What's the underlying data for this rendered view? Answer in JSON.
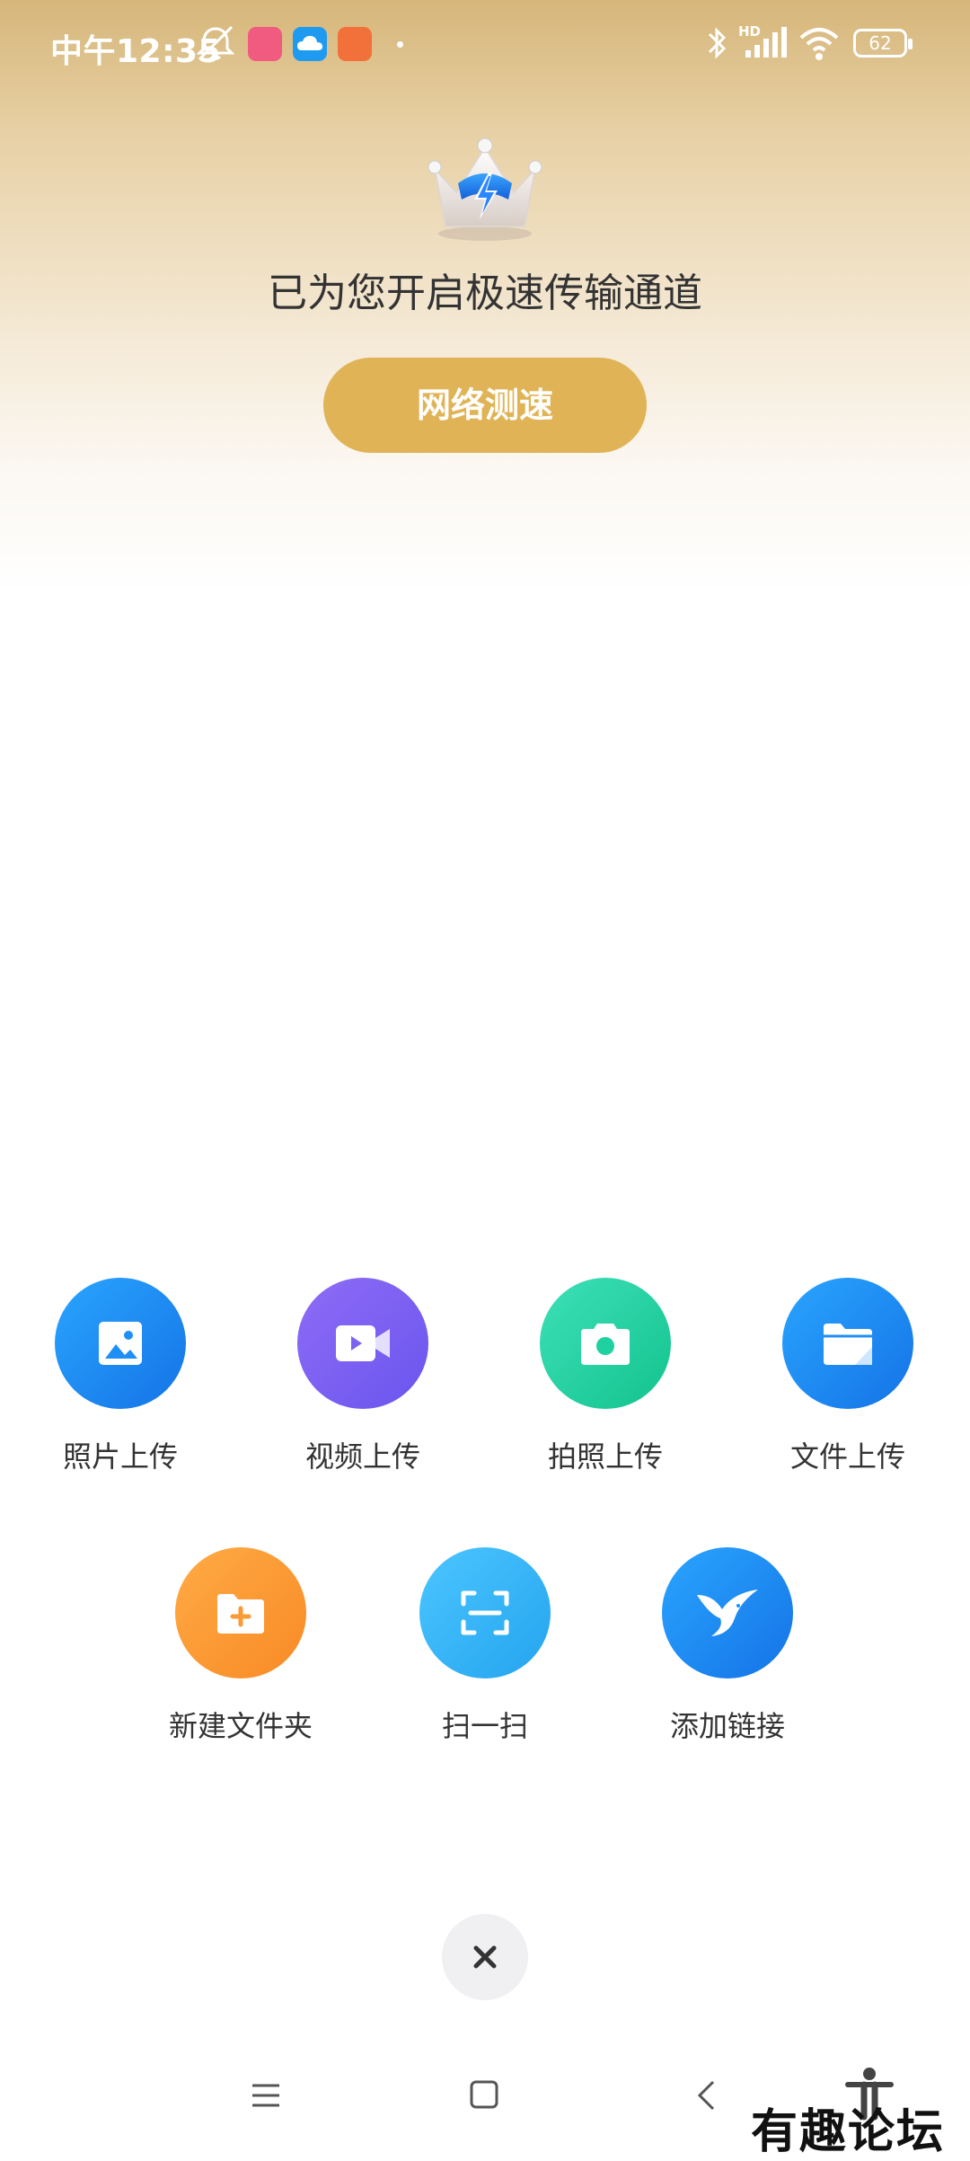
{
  "status_bar": {
    "time": "中午12:35",
    "network_label": "HD",
    "battery_level": "62"
  },
  "hero": {
    "headline": "已为您开启极速传输通道",
    "speed_test_label": "网络测速",
    "accent_color": "#e0b456"
  },
  "actions": {
    "row1": [
      {
        "label": "照片上传",
        "icon": "image-icon",
        "color": "#1e8ff5"
      },
      {
        "label": "视频上传",
        "icon": "video-icon",
        "color": "#7a63f2"
      },
      {
        "label": "拍照上传",
        "icon": "camera-icon",
        "color": "#1fd0a0"
      },
      {
        "label": "文件上传",
        "icon": "folder-icon",
        "color": "#1e8ff5"
      }
    ],
    "row2": [
      {
        "label": "新建文件夹",
        "icon": "new-folder-icon",
        "color": "#f99a35"
      },
      {
        "label": "扫一扫",
        "icon": "scan-icon",
        "color": "#3ab4f5"
      },
      {
        "label": "添加链接",
        "icon": "bird-icon",
        "color": "#1e8ff5"
      }
    ]
  },
  "watermark": "有趣论坛"
}
